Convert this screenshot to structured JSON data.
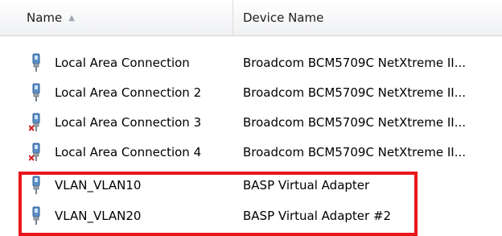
{
  "columns": {
    "name_label": "Name",
    "sort_indicator": "▲",
    "device_label": "Device Name"
  },
  "rows": [
    {
      "name": "Local Area Connection",
      "device": "Broadcom BCM5709C NetXtreme II...",
      "icon": "network-adapter-icon",
      "disconnected": false
    },
    {
      "name": "Local Area Connection 2",
      "device": "Broadcom BCM5709C NetXtreme II...",
      "icon": "network-adapter-icon",
      "disconnected": false
    },
    {
      "name": "Local Area Connection 3",
      "device": "Broadcom BCM5709C NetXtreme II...",
      "icon": "network-adapter-disconnected-icon",
      "disconnected": true
    },
    {
      "name": "Local Area Connection 4",
      "device": "Broadcom BCM5709C NetXtreme II...",
      "icon": "network-adapter-disconnected-icon",
      "disconnected": true
    },
    {
      "name": "VLAN_VLAN10",
      "device": "BASP Virtual Adapter",
      "icon": "network-adapter-icon",
      "disconnected": false
    },
    {
      "name": "VLAN_VLAN20",
      "device": "BASP Virtual Adapter #2",
      "icon": "network-adapter-icon",
      "disconnected": false
    }
  ],
  "colors": {
    "highlight": "#e8161c",
    "error_x": "#d3262a",
    "adapter_blue": "#5a8fc8"
  }
}
